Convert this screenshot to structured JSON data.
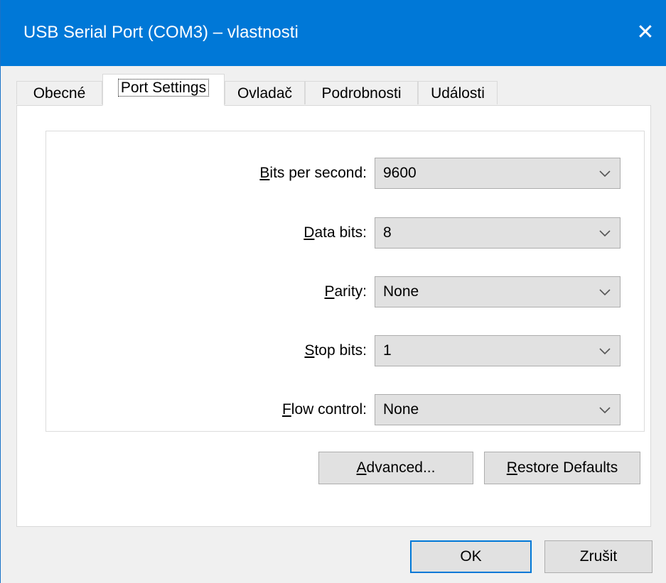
{
  "window": {
    "title": "USB Serial Port (COM3)  – vlastnosti",
    "close_symbol": "✕"
  },
  "tabs": [
    {
      "label": "Obecné",
      "active": false
    },
    {
      "label": "Port Settings",
      "active": true
    },
    {
      "label": "Ovladač",
      "active": false
    },
    {
      "label": "Podrobnosti",
      "active": false
    },
    {
      "label": "Události",
      "active": false
    }
  ],
  "settings": {
    "bits_per_second": {
      "label_u": "B",
      "label_rest": "its per second:",
      "value": "9600"
    },
    "data_bits": {
      "label_u": "D",
      "label_rest": "ata bits:",
      "value": "8"
    },
    "parity": {
      "label_u": "P",
      "label_rest": "arity:",
      "value": "None"
    },
    "stop_bits": {
      "label_u": "S",
      "label_rest": "top bits:",
      "value": "1"
    },
    "flow_control": {
      "label_u": "F",
      "label_rest": "low control:",
      "value": "None"
    }
  },
  "buttons": {
    "advanced": {
      "u": "A",
      "rest": "dvanced..."
    },
    "restore": {
      "u": "R",
      "rest": "estore Defaults"
    },
    "ok": "OK",
    "cancel": "Zrušit"
  },
  "icons": {
    "close": "close-icon",
    "dropdown": "chevron-down-icon"
  },
  "colors": {
    "titlebar": "#0078d7",
    "focus_border": "#0078d7"
  }
}
